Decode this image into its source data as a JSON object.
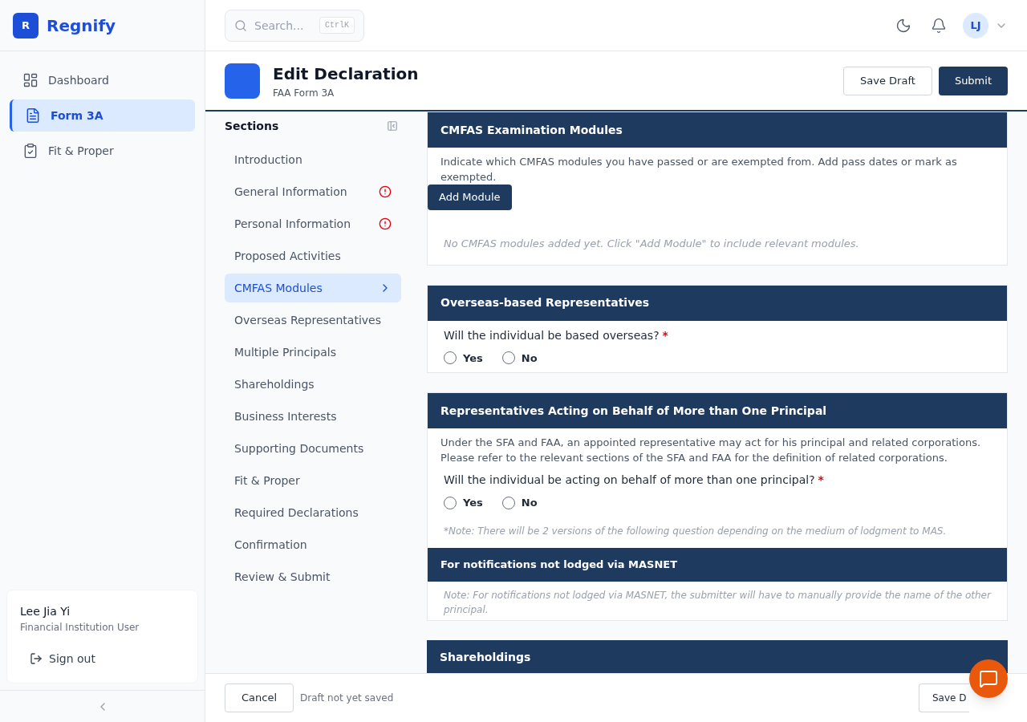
{
  "brand": {
    "logo_letter": "R",
    "name": "Regnify"
  },
  "nav": [
    {
      "kind": "dashboard",
      "label": "Dashboard",
      "selected": false
    },
    {
      "kind": "form",
      "label": "Form 3A",
      "selected": true
    },
    {
      "kind": "clipboard",
      "label": "Fit & Proper",
      "selected": false
    }
  ],
  "user": {
    "name": "Lee Jia Yi",
    "role": "Financial Institution User",
    "sign_out": "Sign out"
  },
  "topbar": {
    "search_placeholder": "Search...",
    "shortcut": "CtrlK",
    "avatar": "LJ"
  },
  "header": {
    "title": "Edit Declaration",
    "subtitle": "FAA Form 3A",
    "buttons": [
      {
        "label": "Save Draft",
        "kind": "secondary"
      },
      {
        "label": "Submit",
        "kind": "primary"
      }
    ]
  },
  "sections": {
    "title": "Sections",
    "items": [
      {
        "label": "Introduction",
        "selected": false,
        "error": false
      },
      {
        "label": "General Information",
        "selected": false,
        "error": true
      },
      {
        "label": "Personal Information",
        "selected": false,
        "error": true
      },
      {
        "label": "Proposed Activities",
        "selected": false,
        "error": false
      },
      {
        "label": "CMFAS Modules",
        "selected": true,
        "error": false
      },
      {
        "label": "Overseas Representatives",
        "selected": false,
        "error": false
      },
      {
        "label": "Multiple Principals",
        "selected": false,
        "error": false
      },
      {
        "label": "Shareholdings",
        "selected": false,
        "error": false
      },
      {
        "label": "Business Interests",
        "selected": false,
        "error": false
      },
      {
        "label": "Supporting Documents",
        "selected": false,
        "error": false
      },
      {
        "label": "Fit & Proper",
        "selected": false,
        "error": false
      },
      {
        "label": "Required Declarations",
        "selected": false,
        "error": false
      },
      {
        "label": "Confirmation",
        "selected": false,
        "error": false
      },
      {
        "label": "Review & Submit",
        "selected": false,
        "error": false
      }
    ]
  },
  "cards": [
    {
      "kind": "modules",
      "title": "CMFAS Examination Modules",
      "description": "Indicate which CMFAS modules you have passed or are exempted from. Add pass dates or mark as exempted.",
      "button": "Add Module",
      "empty": "No CMFAS modules added yet. Click \"Add Module\" to include relevant modules."
    },
    {
      "kind": "question",
      "title": "Overseas-based Representatives",
      "question": "Will the individual be based overseas?",
      "required_mark": "*",
      "options": [
        {
          "label": "Yes",
          "selected": false
        },
        {
          "label": "No",
          "selected": false
        }
      ]
    },
    {
      "kind": "principal",
      "title": "Representatives Acting on Behalf of More than One Principal",
      "description": "Under the SFA and FAA, an appointed representative may act for his principal and related corporations. Please refer to the relevant sections of the SFA and FAA for the definition of related corporations.",
      "question": "Will the individual be acting on behalf of more than one principal?",
      "required_mark": "*",
      "options": [
        {
          "label": "Yes",
          "selected": false
        },
        {
          "label": "No",
          "selected": false
        }
      ],
      "note": "*Note: There will be 2 versions of the following question depending on the medium of lodgment to MAS.",
      "subtitle": "For notifications not lodged via MASNET",
      "subnote": "Note: For notifications not lodged via MASNET, the submitter will have to manually provide the name of the other principal."
    },
    {
      "kind": "header",
      "title": "Shareholdings"
    }
  ],
  "footer": {
    "cancel": "Cancel",
    "status": "Draft not yet saved",
    "save": "Save D"
  }
}
